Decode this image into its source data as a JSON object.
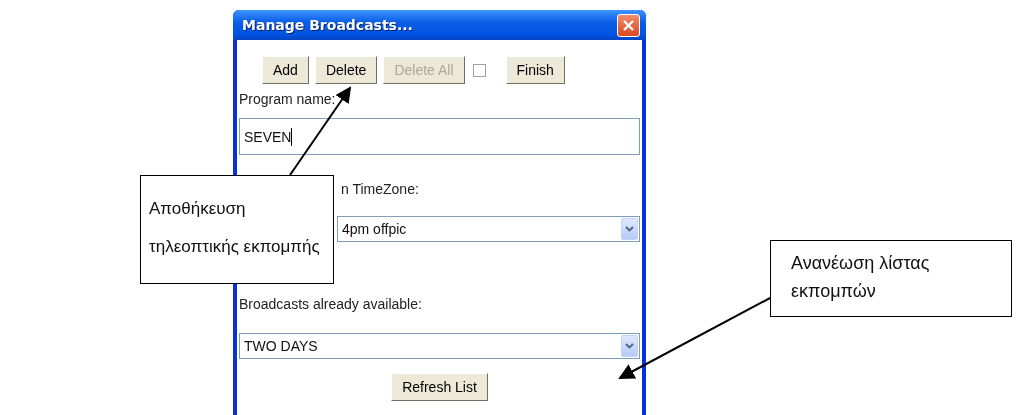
{
  "window": {
    "title": "Manage Broadcasts..."
  },
  "toolbar": [
    {
      "kind": "button",
      "label": "Add",
      "disabled": false
    },
    {
      "kind": "button",
      "label": "Delete",
      "disabled": false
    },
    {
      "kind": "button",
      "label": "Delete All",
      "disabled": true
    },
    {
      "kind": "checkbox",
      "checked": false
    },
    {
      "kind": "button",
      "label": "Finish",
      "disabled": false
    }
  ],
  "program_name": {
    "label": "Program name:",
    "value": "SEVEN"
  },
  "timezone": {
    "label": "n TimeZone:",
    "value": "4pm offpic"
  },
  "broadcasts": {
    "label": "Broadcasts already available:",
    "value": "TWO DAYS"
  },
  "refresh_button": {
    "label": "Refresh List"
  },
  "callouts": [
    {
      "text": "Αποθήκευση τηλεοπτικής εκπομπής"
    },
    {
      "text": "Ανανέωση λίστας εκπομπών"
    }
  ]
}
